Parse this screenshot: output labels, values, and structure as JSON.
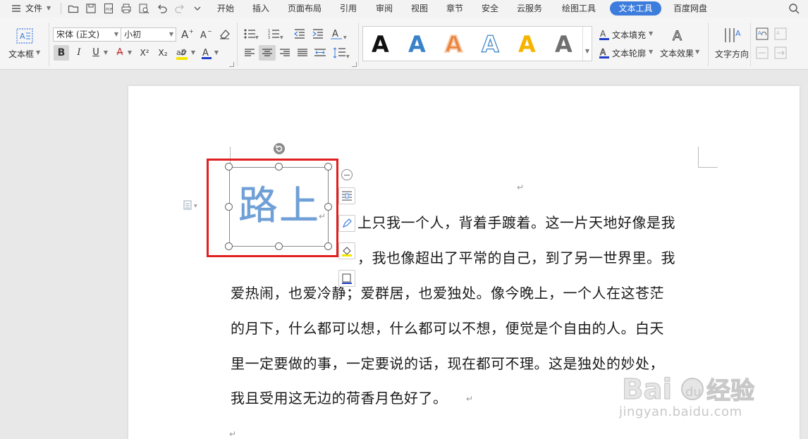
{
  "menubar": {
    "file_label": "文件",
    "tabs": [
      "开始",
      "插入",
      "页面布局",
      "引用",
      "审阅",
      "视图",
      "章节",
      "安全",
      "云服务",
      "绘图工具",
      "文本工具",
      "百度网盘"
    ],
    "active_tab": "文本工具"
  },
  "ribbon": {
    "textbox_label": "文本框",
    "font_name": "宋体 (正文)",
    "font_size": "小初",
    "bold": "B",
    "italic": "I",
    "underline": "U",
    "strikethrough": "A",
    "superscript": "X²",
    "subscript": "X₂",
    "font_color_glyph": "A",
    "text_fill": "文本填充",
    "text_outline": "文本轮廓",
    "text_effect": "文本效果",
    "text_direction": "文字方向",
    "style_glyph": "A",
    "colors": {
      "style1": "#111111",
      "style2": "#3b82c8",
      "style3": "#e8823c",
      "style4": "#ffffff",
      "style5": "#f5b400",
      "style6": "#707070",
      "accent": "#3c7cdc"
    }
  },
  "document": {
    "textbox_text": "路上",
    "paragraph_lines": [
      "上只我一个人，背着手踱着。这一片天地好像是我",
      "，我也像超出了平常的自己，到了另一世界里。我",
      "爱热闹，也爱冷静；爱群居，也爱独处。像今晚上，一个人在这苍茫",
      "的月下，什么都可以想，什么都可以不想，便觉是个自由的人。白天",
      "里一定要做的事，一定要说的话，现在都可不理。这是独处的妙处，",
      "我且受用这无边的荷香月色好了。"
    ],
    "paragraph_mark": "↵"
  },
  "watermark": {
    "brand": "Baidu经验",
    "url": "jingyan.baidu.com"
  }
}
